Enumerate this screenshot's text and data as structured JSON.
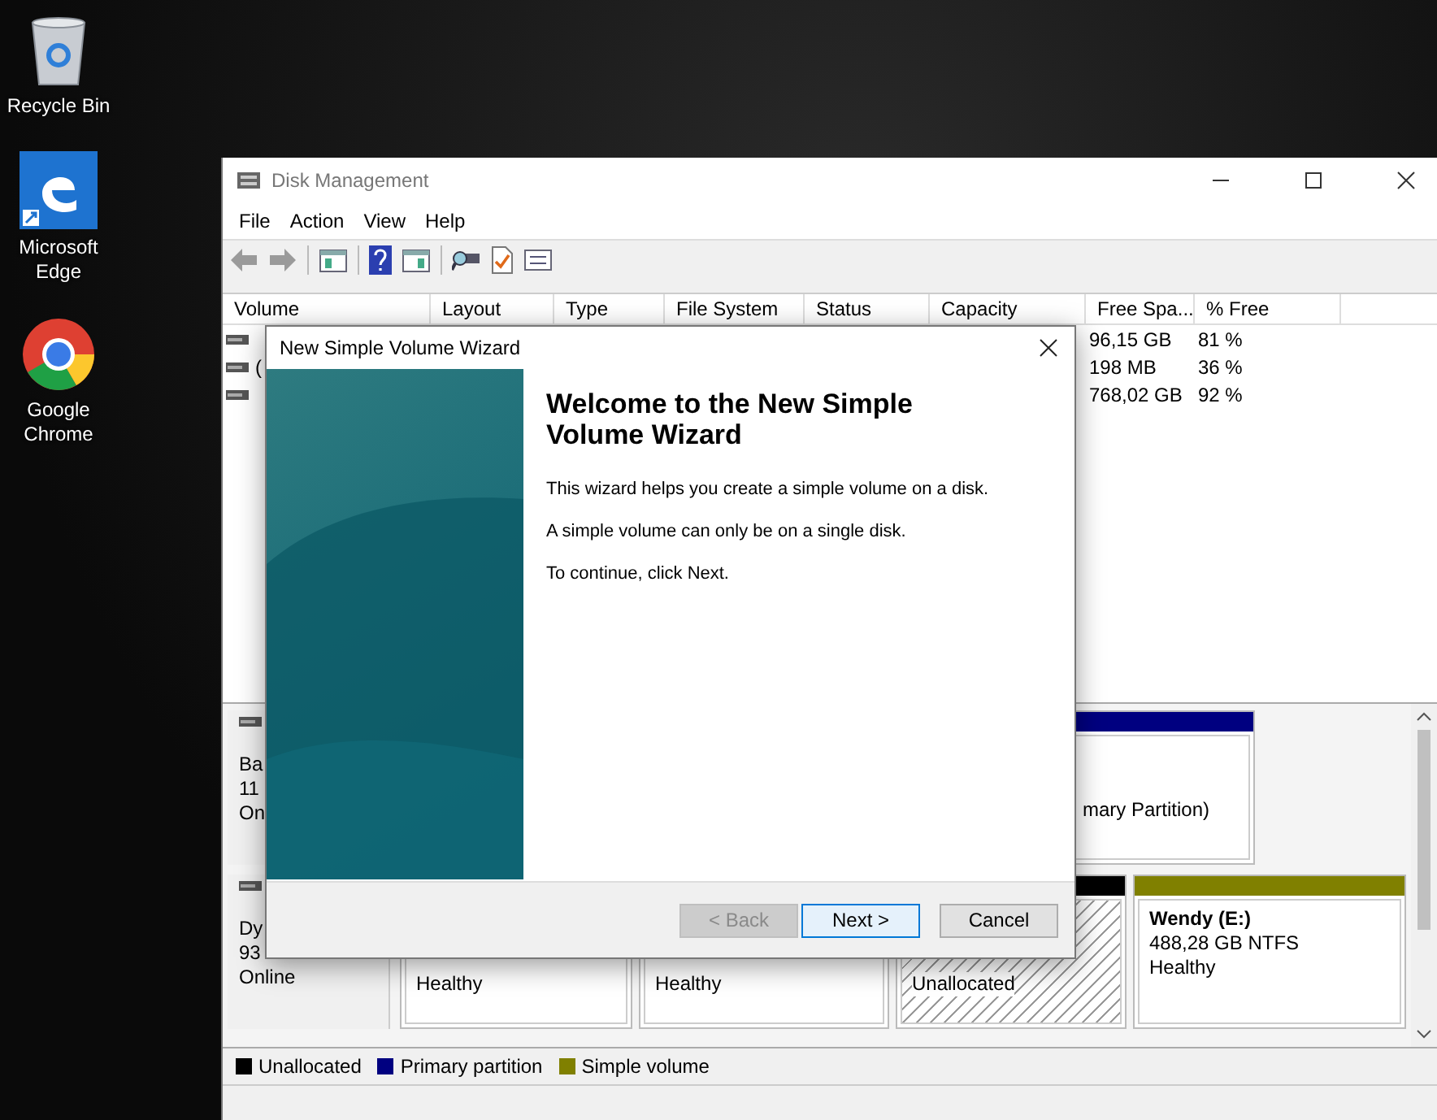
{
  "desktop_icons": [
    {
      "label": "Recycle Bin",
      "kind": "recycle"
    },
    {
      "label": "Microsoft Edge",
      "kind": "edge"
    },
    {
      "label": "Google Chrome",
      "kind": "chrome"
    }
  ],
  "window": {
    "title": "Disk Management"
  },
  "menu": [
    "File",
    "Action",
    "View",
    "Help"
  ],
  "table": {
    "columns": [
      "Volume",
      "Layout",
      "Type",
      "File System",
      "Status",
      "Capacity",
      "Free Spa...",
      "% Free"
    ],
    "rows": [
      {
        "free": "96,15 GB",
        "percent_free": "81 %"
      },
      {
        "volume": "(",
        "free": "198 MB",
        "percent_free": "36 %"
      },
      {
        "free": "768,02 GB",
        "percent_free": "92 %"
      }
    ]
  },
  "disks": [
    {
      "lines": [
        "Ba",
        "11",
        "On"
      ],
      "partitions": [
        {
          "kind": "primary",
          "lines": [
            "mary Partition)"
          ]
        }
      ]
    },
    {
      "lines": [
        "Dy",
        "93",
        "Online"
      ],
      "partitions": [
        {
          "lines": [
            "Healthy"
          ]
        },
        {
          "lines": [
            "Healthy"
          ]
        },
        {
          "kind": "unallocated",
          "lines": [
            "Unallocated"
          ]
        },
        {
          "kind": "simple",
          "name": "Wendy  (E:)",
          "lines": [
            "488,28 GB NTFS",
            "Healthy"
          ]
        }
      ]
    }
  ],
  "legend": [
    {
      "label": "Unallocated",
      "color": "#000000"
    },
    {
      "label": "Primary partition",
      "color": "#000080"
    },
    {
      "label": "Simple volume",
      "color": "#808000"
    }
  ],
  "dialog": {
    "title": "New Simple Volume Wizard",
    "heading": "Welcome to the New Simple Volume Wizard",
    "paragraphs": [
      "This wizard helps you create a simple volume on a disk.",
      "A simple volume can only be on a single disk.",
      "To continue, click Next."
    ],
    "buttons": [
      {
        "label": "< Back",
        "disabled": true,
        "default": false
      },
      {
        "label": "Next >",
        "disabled": false,
        "default": true
      },
      {
        "label": "Cancel",
        "disabled": false,
        "default": false
      }
    ]
  }
}
